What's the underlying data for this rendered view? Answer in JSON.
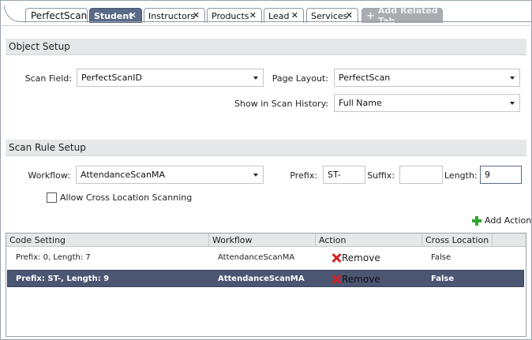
{
  "tabs": [
    {
      "label": "PerfectScan"
    },
    {
      "label": "Student"
    },
    {
      "label": "Instructors"
    },
    {
      "label": "Products"
    },
    {
      "label": "Lead"
    },
    {
      "label": "Services"
    }
  ],
  "add_tab_label": "Add Related Tab",
  "object_setup": {
    "title": "Object Setup",
    "scan_field_label": "Scan Field:",
    "scan_field_value": "PerfectScanID",
    "page_layout_label": "Page Layout:",
    "page_layout_value": "PerfectScan",
    "scan_history_label": "Show in Scan History:",
    "scan_history_value": "Full Name"
  },
  "scan_rule": {
    "title": "Scan Rule Setup",
    "workflow_label": "Workflow:",
    "workflow_value": "AttendanceScanMA",
    "prefix_label": "Prefix:",
    "prefix_value": "ST-",
    "suffix_label": "Suffix:",
    "suffix_value": "",
    "length_label": "Length:",
    "length_value": "9",
    "cross_location_label": "Allow Cross Location Scanning",
    "cross_location_checked": false,
    "add_action_label": "Add Action"
  },
  "grid": {
    "columns": [
      "Code Setting",
      "Workflow",
      "Action",
      "Cross Location"
    ],
    "rows": [
      {
        "code": "Prefix: 0, Length: 7",
        "workflow": "AttendanceScanMA",
        "action": "Remove",
        "cross": "False"
      },
      {
        "code": "Prefix: ST-, Length: 9",
        "workflow": "AttendanceScanMA",
        "action": "Remove",
        "cross": "False"
      }
    ],
    "selected_row": 1
  },
  "colors": {
    "active_tab": "#5a6a86",
    "selected_row": "#4a5672",
    "remove_icon": "#d42222",
    "add_icon": "#2fa52f"
  }
}
